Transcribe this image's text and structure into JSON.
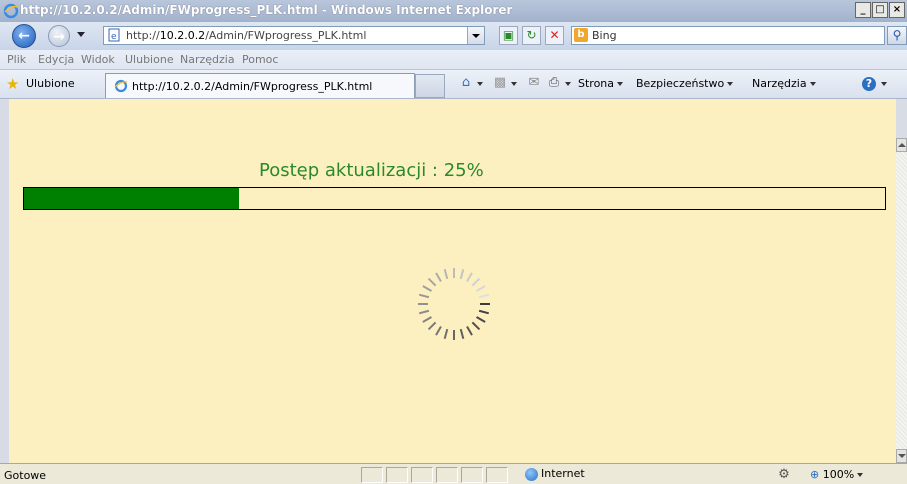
{
  "window": {
    "title": "http://10.2.0.2/Admin/FWprogress_PLK.html - Windows Internet Explorer",
    "minimize": "_",
    "maximize": "□",
    "close": "×"
  },
  "address_bar": {
    "url_prefix": "http://",
    "url_host": "10.2.0.2",
    "url_path": "/Admin/FWprogress_PLK.html",
    "search_placeholder": "Bing"
  },
  "menu": [
    "Plik",
    "Edycja",
    "Widok",
    "Ulubione",
    "Narzędzia",
    "Pomoc"
  ],
  "favorites_bar": {
    "favorites_label": "Ulubione",
    "tab_title": "http://10.2.0.2/Admin/FWprogress_PLK.html",
    "commands": [
      "Strona",
      "Bezpieczeństwo",
      "Narzędzia"
    ]
  },
  "page": {
    "progress_text": "Postęp aktualizacji : 25%",
    "progress_value": 0.25,
    "colors": {
      "background": "#fdf0c0",
      "bar": "#008000",
      "label": "#2a8a2a"
    }
  },
  "status_bar": {
    "status": "Gotowe",
    "zone": "Internet",
    "zoom": "100%"
  }
}
